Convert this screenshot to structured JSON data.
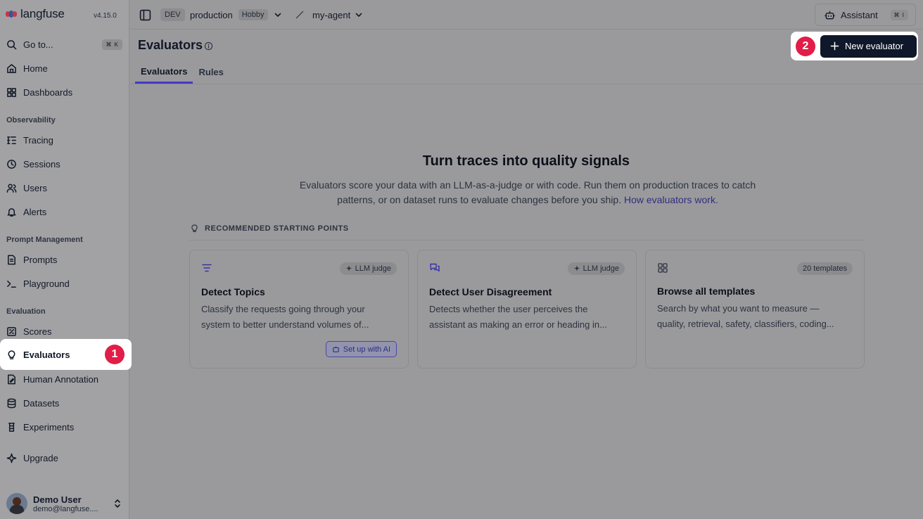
{
  "app": {
    "name": "langfuse",
    "version": "v4.15.0"
  },
  "sidebar": {
    "goto": {
      "label": "Go to...",
      "shortcut": "⌘ K"
    },
    "top_items": [
      {
        "label": "Home",
        "icon": "home-icon"
      },
      {
        "label": "Dashboards",
        "icon": "dashboard-icon"
      }
    ],
    "sections": [
      {
        "title": "Observability",
        "items": [
          "Tracing",
          "Sessions",
          "Users",
          "Alerts"
        ]
      },
      {
        "title": "Prompt Management",
        "items": [
          "Prompts",
          "Playground"
        ]
      },
      {
        "title": "Evaluation",
        "items": [
          "Scores",
          "Evaluators",
          "Human Annotation",
          "Datasets",
          "Experiments"
        ]
      }
    ],
    "upgrade": "Upgrade",
    "user": {
      "name": "Demo User",
      "email": "demo@langfuse...."
    },
    "annotation_badge": "1"
  },
  "topbar": {
    "env": "DEV",
    "project": "production",
    "plan": "Hobby",
    "agent": "my-agent",
    "assistant": {
      "label": "Assistant",
      "shortcut": "⌘ I"
    }
  },
  "page": {
    "title": "Evaluators",
    "new_button": "New evaluator",
    "new_button_badge": "2",
    "tabs": [
      "Evaluators",
      "Rules"
    ],
    "active_tab": "Evaluators"
  },
  "empty_state": {
    "title": "Turn traces into quality signals",
    "description": "Evaluators score your data with an LLM-as-a-judge or with code. Run them on production traces to catch patterns, or on dataset runs to evaluate changes before you ship.",
    "link": "How evaluators work.",
    "recommended_header": "RECOMMENDED STARTING POINTS",
    "cards": [
      {
        "title": "Detect Topics",
        "pill": "LLM judge",
        "description": "Classify the requests going through your system to better understand volumes of...",
        "action": "Set up with AI"
      },
      {
        "title": "Detect User Disagreement",
        "pill": "LLM judge",
        "description": "Detects whether the user perceives the assistant as making an error or heading in..."
      },
      {
        "title": "Browse all templates",
        "pill": "20 templates",
        "description": "Search by what you want to measure — quality, retrieval, safety, classifiers, coding..."
      }
    ]
  },
  "colors": {
    "accent": "#4338ca",
    "primary_button": "#0f172a",
    "badge": "#e11d48"
  }
}
